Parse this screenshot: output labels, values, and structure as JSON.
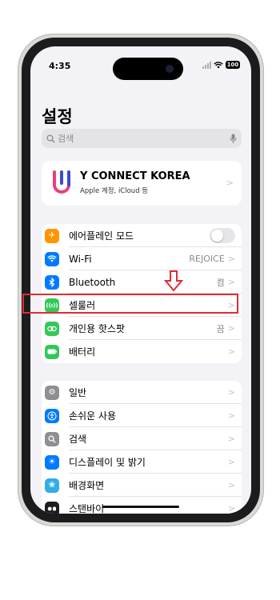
{
  "status_bar": {
    "time": "4:35",
    "battery": "100"
  },
  "page_title": "설정",
  "search": {
    "placeholder": "검색"
  },
  "profile": {
    "name": "Y CONNECT KOREA",
    "subtitle": "Apple 계정, iCloud 등"
  },
  "group1": [
    {
      "label": "에어플레인 모드",
      "icon": "airplane-icon",
      "color": "#ff9500",
      "toggle": "off"
    },
    {
      "label": "Wi-Fi",
      "icon": "wifi-icon",
      "color": "#007aff",
      "value": "REJOICE"
    },
    {
      "label": "Bluetooth",
      "icon": "bluetooth-icon",
      "color": "#007aff",
      "value": "켬"
    },
    {
      "label": "셀룰러",
      "icon": "cellular-icon",
      "color": "#34c759",
      "highlighted": true
    },
    {
      "label": "개인용 핫스팟",
      "icon": "hotspot-icon",
      "color": "#34c759",
      "value": "끔"
    },
    {
      "label": "배터리",
      "icon": "battery-icon",
      "color": "#34c759"
    }
  ],
  "group2": [
    {
      "label": "일반",
      "icon": "gear-icon",
      "color": "#8e8e93"
    },
    {
      "label": "손쉬운 사용",
      "icon": "accessibility-icon",
      "color": "#007aff"
    },
    {
      "label": "검색",
      "icon": "search-icon",
      "color": "#8e8e93"
    },
    {
      "label": "디스플레이 및 밝기",
      "icon": "brightness-icon",
      "color": "#007aff"
    },
    {
      "label": "배경화면",
      "icon": "wallpaper-icon",
      "color": "#32ade6"
    },
    {
      "label": "스탠바이",
      "icon": "standby-icon",
      "color": "#1c1c1e"
    }
  ],
  "annotation": {
    "highlight_color": "#e02b36"
  }
}
